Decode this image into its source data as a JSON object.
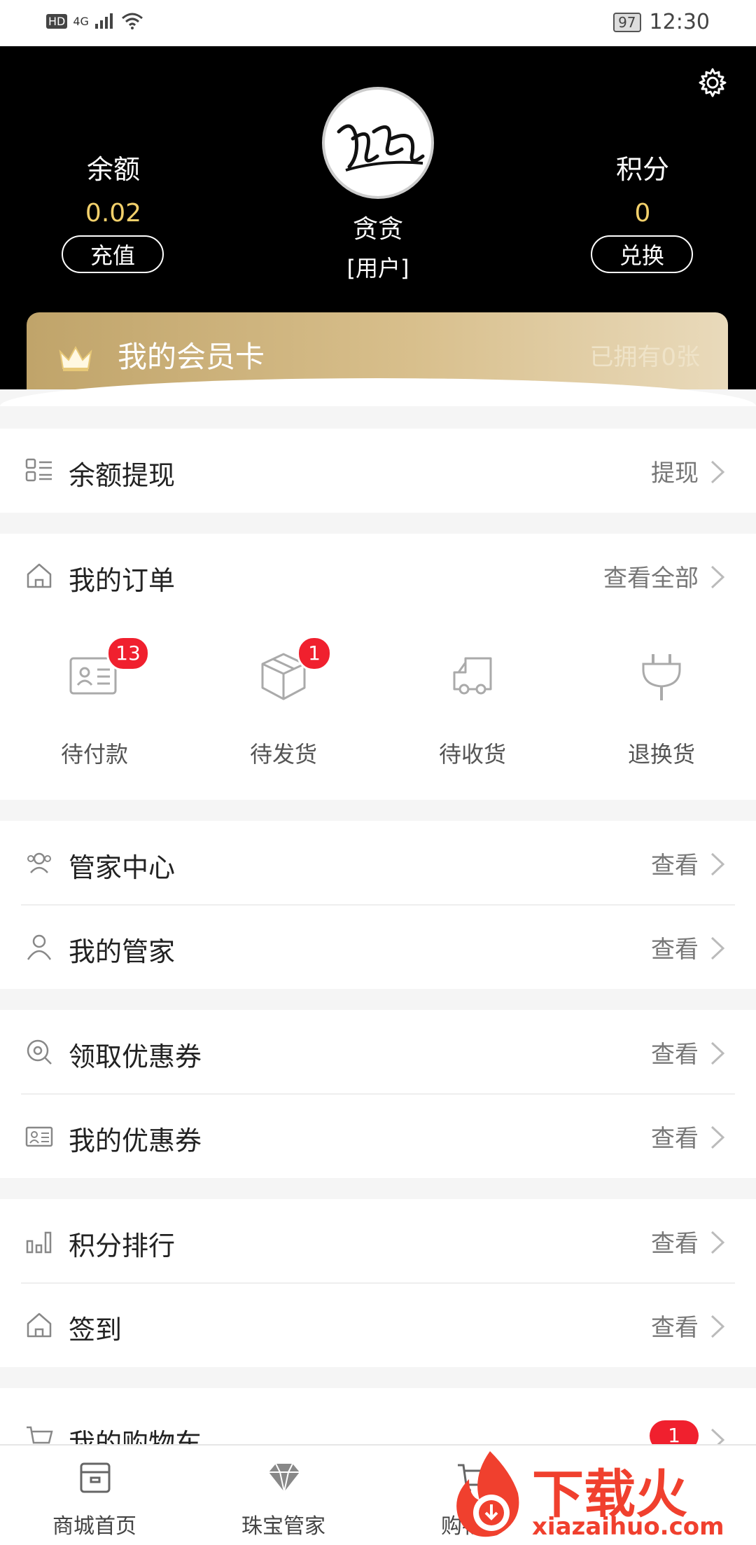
{
  "status_bar": {
    "signal_label": "HD",
    "network": "4G",
    "battery": "97",
    "time": "12:30"
  },
  "header": {
    "balance": {
      "label": "余额",
      "value": "0.02",
      "button": "充值"
    },
    "points": {
      "label": "积分",
      "value": "0",
      "button": "兑换"
    },
    "user": {
      "name": "贪贪",
      "role": "[用户]"
    },
    "vip": {
      "title": "我的会员卡",
      "count_text": "已拥有0张"
    }
  },
  "rows": {
    "withdraw": {
      "title": "余额提现",
      "action": "提现"
    },
    "orders": {
      "title": "我的订单",
      "action": "查看全部"
    },
    "butler_center": {
      "title": "管家中心",
      "action": "查看"
    },
    "my_butler": {
      "title": "我的管家",
      "action": "查看"
    },
    "get_coupon": {
      "title": "领取优惠券",
      "action": "查看"
    },
    "my_coupon": {
      "title": "我的优惠券",
      "action": "查看"
    },
    "points_rank": {
      "title": "积分排行",
      "action": "查看"
    },
    "checkin": {
      "title": "签到",
      "action": "查看"
    },
    "cart": {
      "title": "我的购物车",
      "badge": "1"
    }
  },
  "orders": [
    {
      "label": "待付款",
      "badge": "13",
      "icon": "payment-card-icon"
    },
    {
      "label": "待发货",
      "badge": "1",
      "icon": "package-box-icon"
    },
    {
      "label": "待收货",
      "badge": "",
      "icon": "delivery-truck-icon"
    },
    {
      "label": "退换货",
      "badge": "",
      "icon": "plug-return-icon"
    }
  ],
  "tabbar": [
    {
      "label": "商城首页",
      "icon": "store-icon"
    },
    {
      "label": "珠宝管家",
      "icon": "diamond-icon"
    },
    {
      "label": "购物车",
      "icon": "cart-icon"
    }
  ],
  "watermark": {
    "text": "下载火",
    "sub": "xiazaihuo.com"
  },
  "colors": {
    "gold": "#f2d06b",
    "badge_red": "#f0202e",
    "header_bg": "#000000"
  }
}
